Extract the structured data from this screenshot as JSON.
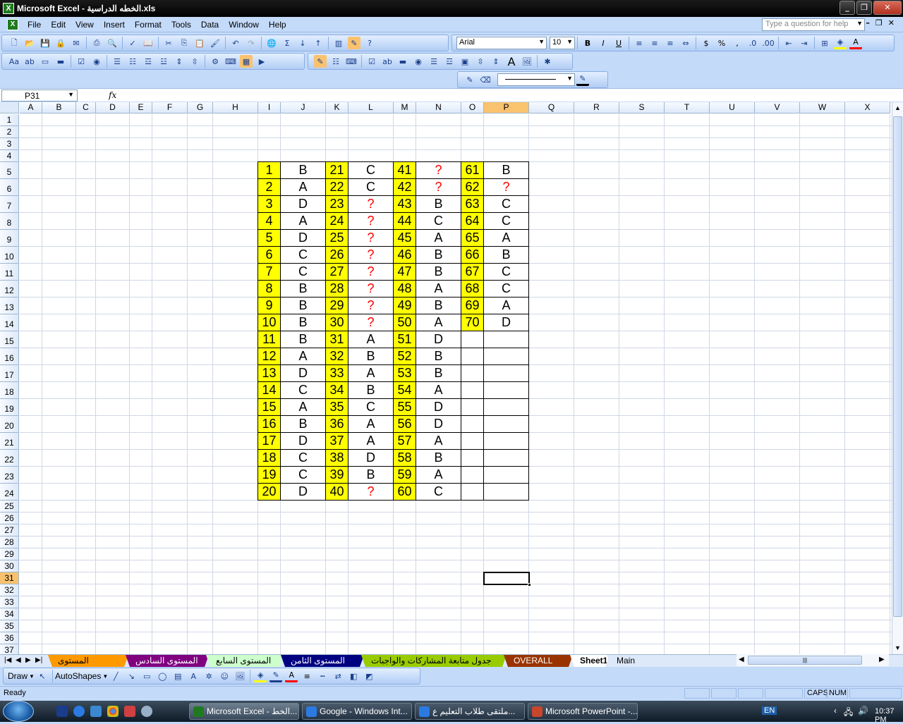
{
  "titlebar": {
    "title": "Microsoft Excel - الخطه الدراسية.xls",
    "icon": "excel-icon"
  },
  "menu": [
    "File",
    "Edit",
    "View",
    "Insert",
    "Format",
    "Tools",
    "Data",
    "Window",
    "Help"
  ],
  "help_placeholder": "Type a question for help",
  "font": {
    "name": "Arial",
    "size": "10"
  },
  "formula_bar": {
    "name_box": "P31",
    "fx": "fx",
    "content": ""
  },
  "columns": [
    "A",
    "B",
    "C",
    "D",
    "E",
    "F",
    "G",
    "H",
    "I",
    "J",
    "K",
    "L",
    "M",
    "N",
    "O",
    "P",
    "Q",
    "R",
    "S",
    "T",
    "U",
    "V",
    "W",
    "X"
  ],
  "rows": [
    "1",
    "2",
    "3",
    "4",
    "5",
    "6",
    "7",
    "8",
    "9",
    "10",
    "11",
    "12",
    "13",
    "14",
    "15",
    "16",
    "17",
    "18",
    "19",
    "20",
    "21",
    "22",
    "23",
    "24",
    "25",
    "26",
    "27",
    "28",
    "29",
    "30",
    "31",
    "32",
    "33",
    "34",
    "35",
    "36",
    "37"
  ],
  "selected_cell": {
    "column": "P",
    "row": "31"
  },
  "table": {
    "first_row": 5,
    "columns": [
      "I",
      "J",
      "K",
      "L",
      "M",
      "N",
      "O",
      "P"
    ],
    "data": [
      [
        "1",
        "B",
        "21",
        "C",
        "41",
        "?",
        "61",
        "B"
      ],
      [
        "2",
        "A",
        "22",
        "C",
        "42",
        "?",
        "62",
        "?"
      ],
      [
        "3",
        "D",
        "23",
        "?",
        "43",
        "B",
        "63",
        "C"
      ],
      [
        "4",
        "A",
        "24",
        "?",
        "44",
        "C",
        "64",
        "C"
      ],
      [
        "5",
        "D",
        "25",
        "?",
        "45",
        "A",
        "65",
        "A"
      ],
      [
        "6",
        "C",
        "26",
        "?",
        "46",
        "B",
        "66",
        "B"
      ],
      [
        "7",
        "C",
        "27",
        "?",
        "47",
        "B",
        "67",
        "C"
      ],
      [
        "8",
        "B",
        "28",
        "?",
        "48",
        "A",
        "68",
        "C"
      ],
      [
        "9",
        "B",
        "29",
        "?",
        "49",
        "B",
        "69",
        "A"
      ],
      [
        "10",
        "B",
        "30",
        "?",
        "50",
        "A",
        "70",
        "D"
      ],
      [
        "11",
        "B",
        "31",
        "A",
        "51",
        "D",
        "",
        ""
      ],
      [
        "12",
        "A",
        "32",
        "B",
        "52",
        "B",
        "",
        ""
      ],
      [
        "13",
        "D",
        "33",
        "A",
        "53",
        "B",
        "",
        ""
      ],
      [
        "14",
        "C",
        "34",
        "B",
        "54",
        "A",
        "",
        ""
      ],
      [
        "15",
        "A",
        "35",
        "C",
        "55",
        "D",
        "",
        ""
      ],
      [
        "16",
        "B",
        "36",
        "A",
        "56",
        "D",
        "",
        ""
      ],
      [
        "17",
        "D",
        "37",
        "A",
        "57",
        "A",
        "",
        ""
      ],
      [
        "18",
        "C",
        "38",
        "D",
        "58",
        "B",
        "",
        ""
      ],
      [
        "19",
        "C",
        "39",
        "B",
        "59",
        "A",
        "",
        ""
      ],
      [
        "20",
        "D",
        "40",
        "?",
        "60",
        "C",
        "",
        ""
      ]
    ],
    "number_fill": "#ffff00",
    "question_color": "#ff0000"
  },
  "sheet_tabs": [
    {
      "label": "المستوى الخامس",
      "color": "#ff9900",
      "text_color": "#000000"
    },
    {
      "label": "المستوى السادس",
      "color": "#800080",
      "text_color": "#ffffff"
    },
    {
      "label": "المستوى السابع",
      "color": "#ccffcc",
      "text_color": "#000000"
    },
    {
      "label": "المستوى الثامن",
      "color": "#000080",
      "text_color": "#ffffff"
    },
    {
      "label": "جدول متابعة المشاركات والواجبات",
      "color": "#99cc00",
      "text_color": "#000000"
    },
    {
      "label": "OVERALL GPA",
      "color": "#993300",
      "text_color": "#ffffff"
    },
    {
      "label": "Sheet1",
      "color": "#ffffff",
      "text_color": "#000000",
      "active": true
    },
    {
      "label": "Main Page",
      "color": "#dde9f9",
      "text_color": "#000000"
    }
  ],
  "drawbar": {
    "draw_label": "Draw",
    "autoshapes_label": "AutoShapes"
  },
  "status": {
    "left": "Ready",
    "caps": "CAPS",
    "num": "NUM"
  },
  "taskbar": {
    "tasks": [
      {
        "label": "Microsoft Excel - الخط...",
        "active": true,
        "icon_color": "#1f7a1f"
      },
      {
        "label": "Google - Windows Int...",
        "active": false,
        "icon_color": "#2a7ae2"
      },
      {
        "label": "ملتقى طلاب التعليم ع...",
        "active": false,
        "icon_color": "#2a7ae2"
      },
      {
        "label": "Microsoft PowerPoint -...",
        "active": false,
        "icon_color": "#c8462c"
      }
    ],
    "lang": "EN",
    "clock": "10:37 PM"
  }
}
